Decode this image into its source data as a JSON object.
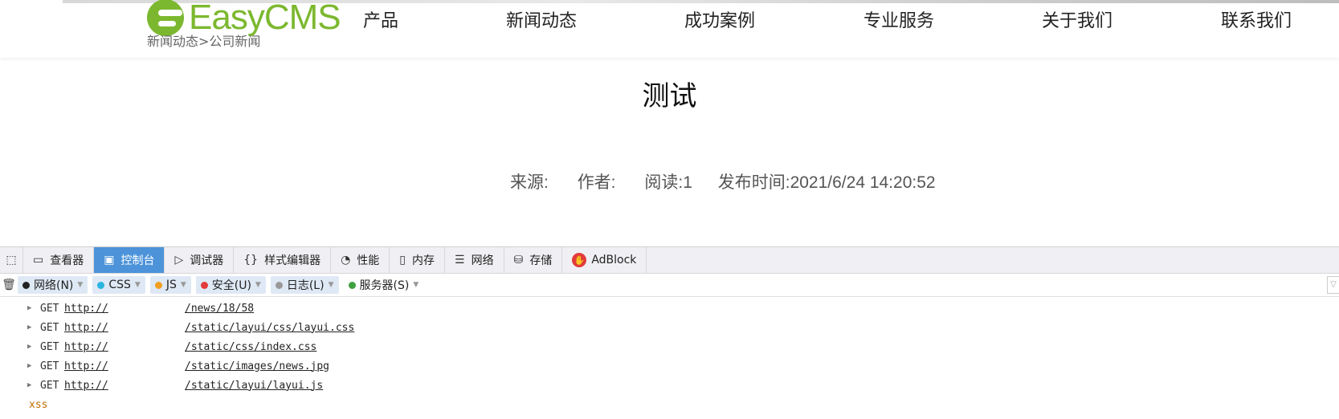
{
  "site": {
    "logo_text": "EasyCMS",
    "nav": [
      "产品",
      "新闻动态",
      "成功案例",
      "专业服务",
      "关于我们",
      "联系我们"
    ],
    "breadcrumb": "新闻动态>公司新闻"
  },
  "article": {
    "title": "测试",
    "source": "来源:",
    "author": "作者:",
    "reads": "阅读:1",
    "published": "发布时间:2021/6/24 14:20:52"
  },
  "devtools": {
    "tabs": [
      {
        "label": "查看器",
        "icon": "inspector-icon"
      },
      {
        "label": "控制台",
        "icon": "console-icon",
        "active": true
      },
      {
        "label": "调试器",
        "icon": "debugger-icon"
      },
      {
        "label": "样式编辑器",
        "icon": "style-editor-icon"
      },
      {
        "label": "性能",
        "icon": "performance-icon"
      },
      {
        "label": "内存",
        "icon": "memory-icon"
      },
      {
        "label": "网络",
        "icon": "network-icon"
      },
      {
        "label": "存储",
        "icon": "storage-icon"
      },
      {
        "label": "AdBlock",
        "icon": "adblock-icon"
      }
    ],
    "filters": [
      {
        "label": "网络(N)",
        "color": "#222222"
      },
      {
        "label": "CSS",
        "color": "#2bb5e0"
      },
      {
        "label": "JS",
        "color": "#f0a020"
      },
      {
        "label": "安全(U)",
        "color": "#e23b3b"
      },
      {
        "label": "日志(L)",
        "color": "#999999"
      },
      {
        "label": "服务器(S)",
        "color": "#3fa03f"
      }
    ],
    "log": [
      {
        "method": "GET",
        "url_prefix": "http://",
        "path": "/news/18/58"
      },
      {
        "method": "GET",
        "url_prefix": "http://",
        "path": "/static/layui/css/layui.css"
      },
      {
        "method": "GET",
        "url_prefix": "http://",
        "path": "/static/css/index.css"
      },
      {
        "method": "GET",
        "url_prefix": "http://",
        "path": "/static/images/news.jpg"
      },
      {
        "method": "GET",
        "url_prefix": "http://",
        "path": "/static/layui/layui.js"
      }
    ],
    "output": "xss"
  }
}
